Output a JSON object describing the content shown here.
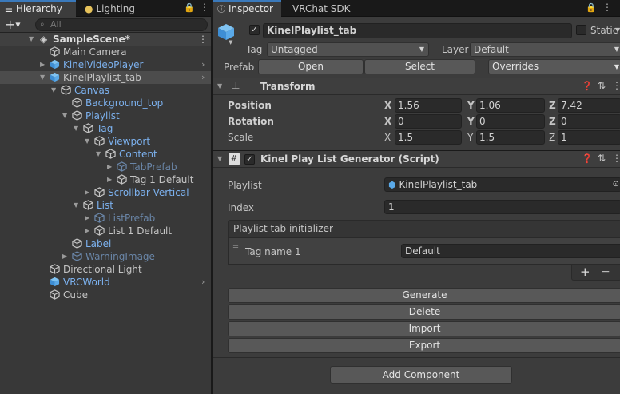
{
  "hierarchy": {
    "tab_label": "Hierarchy",
    "lighting_tab": "Lighting",
    "add_label": "+",
    "search_placeholder": "All",
    "scene": "SampleScene*",
    "items": [
      {
        "label": "Main Camera"
      },
      {
        "label": "KinelVideoPlayer"
      },
      {
        "label": "KinelPlaylist_tab"
      },
      {
        "label": "Canvas"
      },
      {
        "label": "Background_top"
      },
      {
        "label": "Playlist"
      },
      {
        "label": "Tag"
      },
      {
        "label": "Viewport"
      },
      {
        "label": "Content"
      },
      {
        "label": "TabPrefab"
      },
      {
        "label": "Tag 1 Default"
      },
      {
        "label": "Scrollbar Vertical"
      },
      {
        "label": "List"
      },
      {
        "label": "ListPrefab"
      },
      {
        "label": "List 1 Default"
      },
      {
        "label": "Label"
      },
      {
        "label": "WarningImage"
      },
      {
        "label": "Directional Light"
      },
      {
        "label": "VRCWorld"
      },
      {
        "label": "Cube"
      }
    ]
  },
  "inspector": {
    "tab_label": "Inspector",
    "sdk_tab": "VRChat SDK",
    "object_name": "KinelPlaylist_tab",
    "static_label": "Static",
    "tag_label": "Tag",
    "tag_value": "Untagged",
    "layer_label": "Layer",
    "layer_value": "Default",
    "prefab_label": "Prefab",
    "open_button": "Open",
    "select_button": "Select",
    "overrides_button": "Overrides",
    "transform": {
      "title": "Transform",
      "position_label": "Position",
      "rotation_label": "Rotation",
      "scale_label": "Scale",
      "position": {
        "x": "1.56",
        "y": "1.06",
        "z": "7.42"
      },
      "rotation": {
        "x": "0",
        "y": "0",
        "z": "0"
      },
      "scale": {
        "x": "1.5",
        "y": "1.5",
        "z": "1"
      }
    },
    "script": {
      "title": "Kinel Play List Generator (Script)",
      "playlist_label": "Playlist",
      "playlist_value": "KinelPlaylist_tab",
      "index_label": "Index",
      "index_value": "1",
      "initializer_label": "Playlist tab initializer",
      "tag_name_label": "Tag name 1",
      "tag_name_value": "Default",
      "plus": "+",
      "minus": "−",
      "generate": "Generate",
      "delete": "Delete",
      "import": "Import",
      "export": "Export"
    },
    "add_component": "Add Component"
  }
}
